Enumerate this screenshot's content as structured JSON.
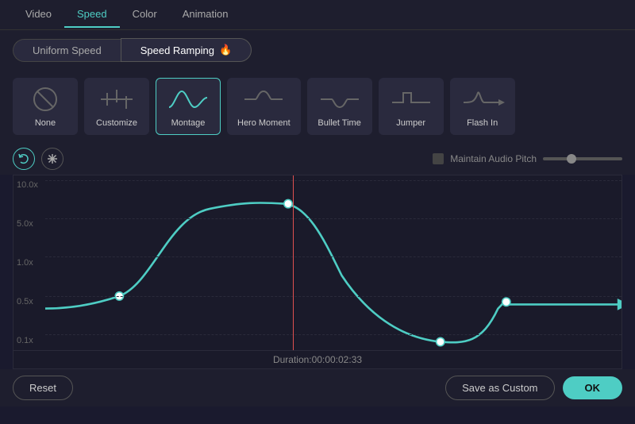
{
  "nav": {
    "tabs": [
      {
        "label": "Video",
        "active": false
      },
      {
        "label": "Speed",
        "active": true
      },
      {
        "label": "Color",
        "active": false
      },
      {
        "label": "Animation",
        "active": false
      }
    ]
  },
  "speed_toggle": {
    "uniform": "Uniform Speed",
    "ramping": "Speed Ramping",
    "fire": "🔥"
  },
  "presets": [
    {
      "label": "None",
      "type": "none"
    },
    {
      "label": "Customize",
      "type": "customize"
    },
    {
      "label": "Montage",
      "type": "montage",
      "selected": true
    },
    {
      "label": "Hero Moment",
      "type": "hero"
    },
    {
      "label": "Bullet Time",
      "type": "bullet"
    },
    {
      "label": "Jumper",
      "type": "jumper"
    },
    {
      "label": "Flash In",
      "type": "flashin"
    }
  ],
  "controls": {
    "icon1": "↩",
    "icon2": "❄"
  },
  "chart": {
    "y_labels": [
      "10.0x",
      "5.0x",
      "1.0x",
      "0.5x",
      "0.1x"
    ],
    "duration": "Duration:00:00:02:33",
    "audio_pitch_label": "Maintain Audio Pitch",
    "red_line_pct": 46
  },
  "buttons": {
    "reset": "Reset",
    "save_custom": "Save as Custom",
    "ok": "OK"
  }
}
